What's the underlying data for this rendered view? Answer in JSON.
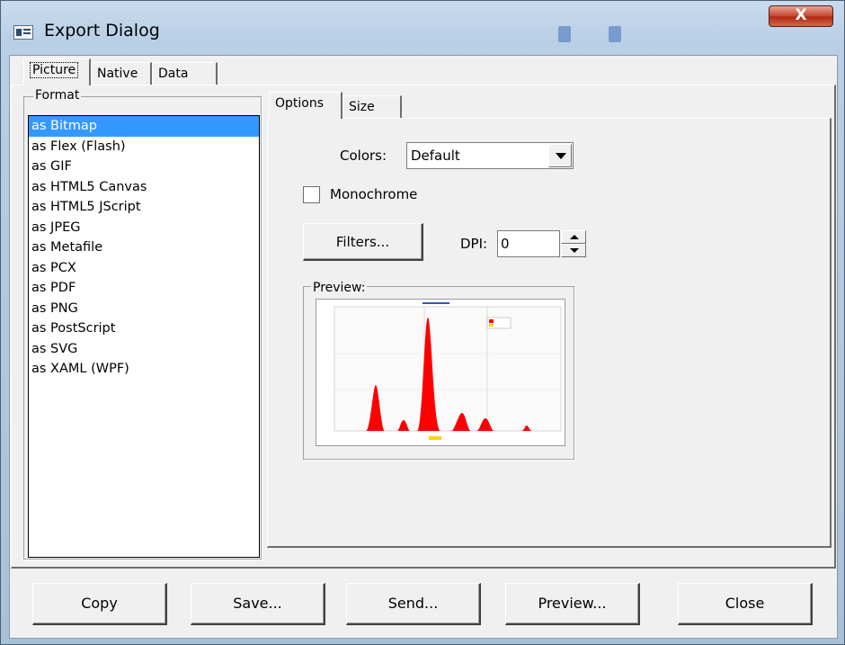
{
  "window": {
    "title": "Export Dialog",
    "close_glyph": "X"
  },
  "outer_tabs": [
    {
      "label": "Picture",
      "active": true
    },
    {
      "label": "Native",
      "active": false
    },
    {
      "label": "Data",
      "active": false
    }
  ],
  "format": {
    "group_label": "Format",
    "items": [
      "as Bitmap",
      "as Flex (Flash)",
      "as GIF",
      "as HTML5 Canvas",
      "as HTML5 JScript",
      "as JPEG",
      "as Metafile",
      "as PCX",
      "as PDF",
      "as PNG",
      "as PostScript",
      "as SVG",
      "as XAML (WPF)"
    ],
    "selected": "as Bitmap"
  },
  "inner_tabs": [
    {
      "label": "Options",
      "active": true
    },
    {
      "label": "Size",
      "active": false
    }
  ],
  "options": {
    "colors_label": "Colors:",
    "colors_value": "Default",
    "monochrome_label": "Monochrome",
    "monochrome_checked": false,
    "filters_button": "Filters...",
    "dpi_label": "DPI:",
    "dpi_value": "0",
    "preview_label": "Preview:"
  },
  "buttons": {
    "copy": "Copy",
    "save": "Save...",
    "send": "Send...",
    "preview": "Preview...",
    "close": "Close"
  },
  "colors": {
    "selection": "#3399ff",
    "chart_fill": "#ff0000",
    "title_close": "#c8503a"
  }
}
